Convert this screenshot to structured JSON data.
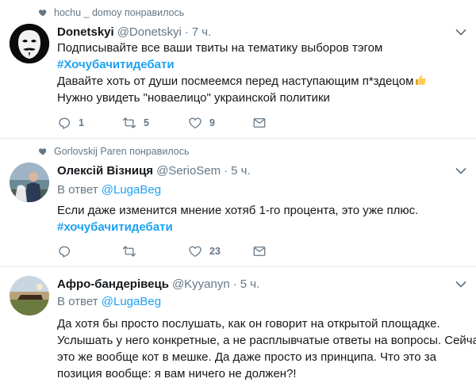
{
  "tweets": [
    {
      "social_context": "hochu _ domoy понравилось",
      "name": "Donetskyi",
      "handle": "@Donetskyi",
      "time": "7 ч.",
      "lines": [
        "Подписывайте все ваши твиты на тематику выборов тэгом",
        "#Хочубачитидебати",
        "Давайте хоть от души посмеемся перед наступающим п*здецом",
        "Нужно увидеть \"новаелицо\" украинской политики"
      ],
      "reply_count": "1",
      "retweet_count": "5",
      "like_count": "9"
    },
    {
      "social_context": "Gorlovskij Paren понравилось",
      "name": "Олексій Візниця",
      "handle": "@SerioSem",
      "time": "5 ч.",
      "reply_prefix": "В ответ",
      "reply_mention": "@LugaBeg",
      "lines": [
        "Если даже изменится мнение хотяб 1-го процента, это уже плюс.",
        "#хочубачитидебати"
      ],
      "like_count": "23"
    },
    {
      "name": "Афро-бандерівець",
      "handle": "@Kyyanyn",
      "time": "5 ч.",
      "reply_prefix": "В ответ",
      "reply_mention": "@LugaBeg",
      "lines": [
        "Да хотя бы просто послушать, как он говорит на открытой площадке.",
        "Услышать у него конкретные, а не расплывчатые ответы на вопросы. Сейчас",
        "это же вообще кот в мешке.  Да даже просто из принципа. Что это за",
        "позиция вообще: я вам ничего не должен?!"
      ]
    }
  ],
  "separator": "·",
  "colors": {
    "accent": "#1da1f2",
    "muted": "#657786",
    "text": "#14171a",
    "border": "#e1e8ed"
  }
}
